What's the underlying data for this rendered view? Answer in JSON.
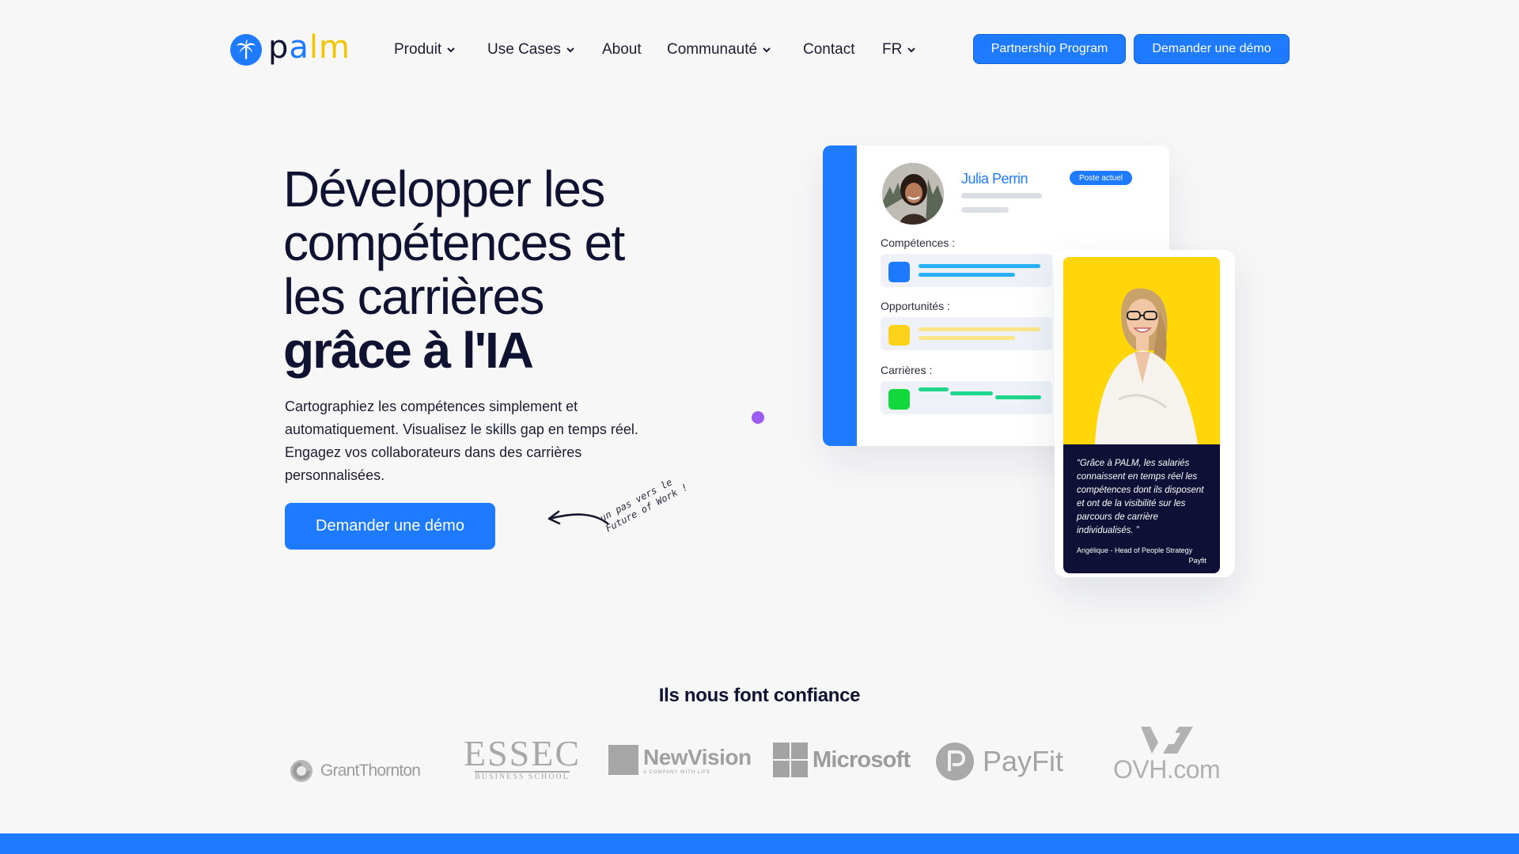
{
  "brand": {
    "name": "palm",
    "colors": {
      "primary": "#1e7bff",
      "dark": "#0f1230",
      "yellow": "#ffd21a",
      "green": "#11d93c",
      "purple": "#9b5cf0"
    }
  },
  "nav": {
    "items": [
      {
        "label": "Produit",
        "dropdown": true
      },
      {
        "label": "Use Cases",
        "dropdown": true
      },
      {
        "label": "About",
        "dropdown": false
      },
      {
        "label": "Communauté",
        "dropdown": true
      },
      {
        "label": "Contact",
        "dropdown": false
      },
      {
        "label": "FR",
        "dropdown": true
      }
    ],
    "partnership_label": "Partnership Program",
    "demo_label": "Demander une démo"
  },
  "hero": {
    "title_lines": [
      "Développer les",
      "compétences et",
      "les carrières"
    ],
    "title_bold": "grâce à l'IA",
    "description": "Cartographiez les compétences simplement et automatiquement. Visualisez le skills gap en temps réel. Engagez vos collaborateurs dans des carrières personnalisées.",
    "cta_label": "Demander une démo",
    "handwritten_note": "un pas vers le Future of Work !"
  },
  "profile_card": {
    "name": "Julia Perrin",
    "badge": "Poste actuel",
    "sections": [
      {
        "label": "Compétences :"
      },
      {
        "label": "Opportunités :"
      },
      {
        "label": "Carrières :"
      }
    ]
  },
  "testimonial": {
    "quote": "“Grâce à PALM, les salariés connaissent en temps réel les compétences dont ils disposent et ont de la visibilité sur les parcours de carrière individualisés. ”",
    "author": "Angélique - Head of People Strategy",
    "company": "Payfit"
  },
  "trust": {
    "title": "Ils nous font confiance",
    "logos": {
      "grant_thornton": "GrantThornton",
      "essec_main": "ESSEC",
      "essec_sub": "BUSINESS SCHOOL",
      "newvision": "NewVision",
      "newvision_sub": "A COMPANY WITH LIFE",
      "microsoft": "Microsoft",
      "payfit": "PayFit",
      "ovh": "OVH.com"
    }
  }
}
